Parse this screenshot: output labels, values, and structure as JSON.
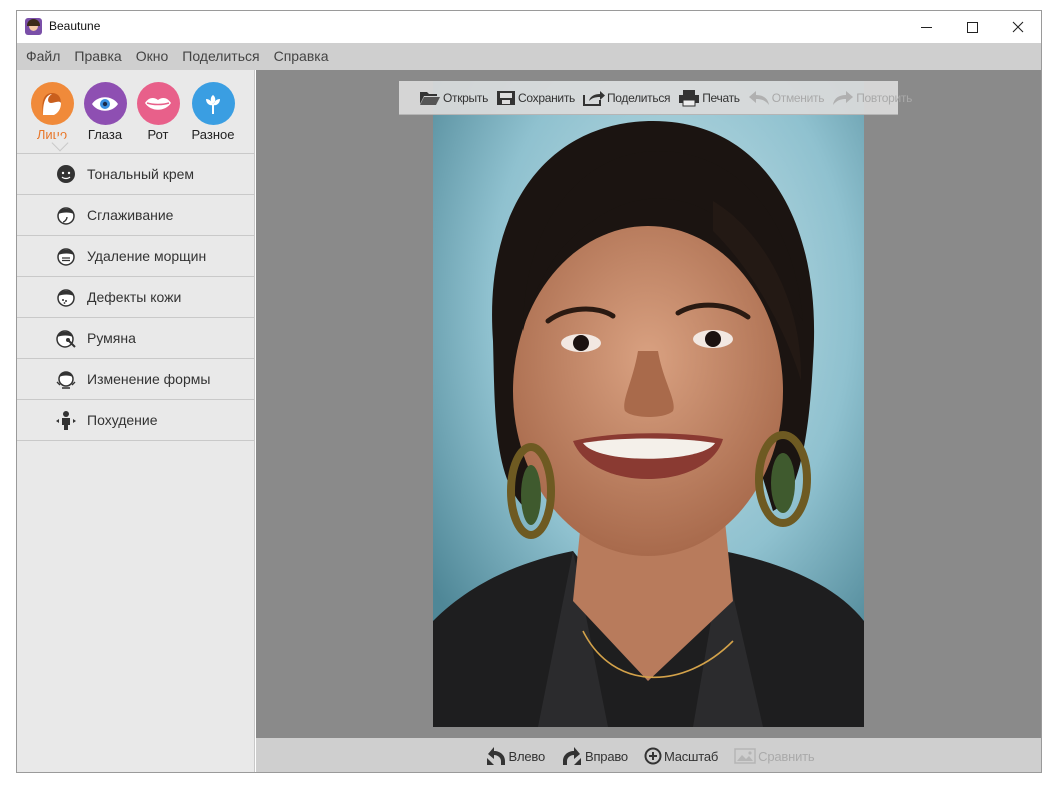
{
  "window": {
    "title": "Beautune"
  },
  "menu": [
    "Файл",
    "Правка",
    "Окно",
    "Поделиться",
    "Справка"
  ],
  "categories": [
    {
      "label": "Лицо",
      "icon": "face-icon",
      "color": "#f08a3a",
      "active": true
    },
    {
      "label": "Глаза",
      "icon": "eye-icon",
      "color": "#8e4fb2",
      "active": false
    },
    {
      "label": "Рот",
      "icon": "lips-icon",
      "color": "#e8608a",
      "active": false
    },
    {
      "label": "Разное",
      "icon": "flower-icon",
      "color": "#3a9ee2",
      "active": false
    }
  ],
  "tools": [
    {
      "label": "Тональный крем",
      "icon": "foundation-icon"
    },
    {
      "label": "Сглаживание",
      "icon": "smoothing-icon"
    },
    {
      "label": "Удаление морщин",
      "icon": "wrinkle-removal-icon"
    },
    {
      "label": "Дефекты кожи",
      "icon": "skin-defects-icon"
    },
    {
      "label": "Румяна",
      "icon": "blush-icon"
    },
    {
      "label": "Изменение формы",
      "icon": "reshape-icon"
    },
    {
      "label": "Похудение",
      "icon": "slimming-icon"
    }
  ],
  "toolbar": {
    "open": "Открыть",
    "save": "Сохранить",
    "share": "Поделиться",
    "print": "Печать",
    "undo": "Отменить",
    "redo": "Повторить"
  },
  "bottom_bar": {
    "left": "Влево",
    "right": "Вправо",
    "zoom": "Масштаб",
    "compare": "Сравнить"
  },
  "colors": {
    "accent": "#e8772a",
    "canvas_bg": "#8a8a8a",
    "photo_bg": "#8fc1cf"
  }
}
